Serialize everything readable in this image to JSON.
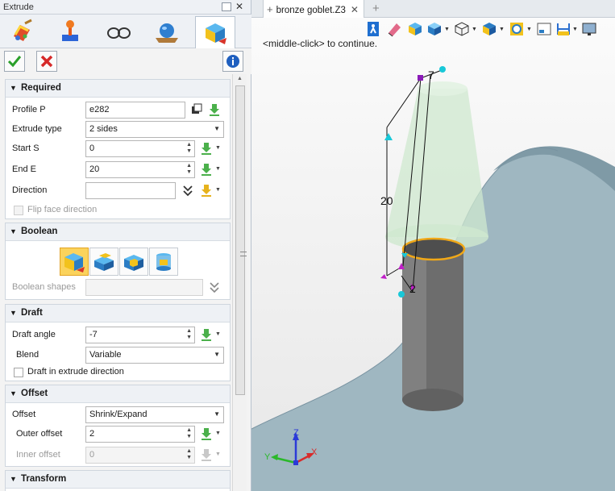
{
  "panel": {
    "title": "Extrude",
    "tool_icons": [
      "extrude-solid-icon",
      "joystick-icon",
      "glasses-icon",
      "sphere-plane-icon",
      "extrude-active-icon"
    ],
    "ok_icon": "checkmark-icon",
    "cancel_icon": "x-icon",
    "info_icon": "info-icon"
  },
  "required": {
    "title": "Required",
    "profile_label": "Profile P",
    "profile_value": "e282",
    "extrude_type_label": "Extrude type",
    "extrude_type_value": "2 sides",
    "start_label": "Start S",
    "start_value": "0",
    "end_label": "End E",
    "end_value": "20",
    "direction_label": "Direction",
    "direction_value": "",
    "flip_label": "Flip face direction"
  },
  "boolean": {
    "title": "Boolean",
    "shapes_label": "Boolean shapes",
    "shapes_value": ""
  },
  "draft": {
    "title": "Draft",
    "angle_label": "Draft angle",
    "angle_value": "-7",
    "blend_label": "Blend",
    "blend_value": "Variable",
    "extrude_dir_label": "Draft in extrude direction"
  },
  "offset": {
    "title": "Offset",
    "offset_label": "Offset",
    "offset_value": "Shrink/Expand",
    "outer_label": "Outer offset",
    "outer_value": "2",
    "inner_label": "Inner offset",
    "inner_value": "0"
  },
  "transform": {
    "title": "Transform"
  },
  "viewport": {
    "tab_title": "bronze goblet.Z3",
    "hint": "<middle-click> to continue.",
    "dim_20": "20",
    "dim_2": "2",
    "dim_7": "7",
    "axis_x": "X",
    "axis_y": "Y",
    "axis_z": "Z",
    "colors": {
      "surface": "#9bb3bd",
      "cylinder": "#6b6b6b",
      "profile": "#f0a818",
      "draft_body": "#cfe8cf",
      "handle_cyan": "#18c8d8",
      "handle_magenta": "#c020c8"
    }
  }
}
